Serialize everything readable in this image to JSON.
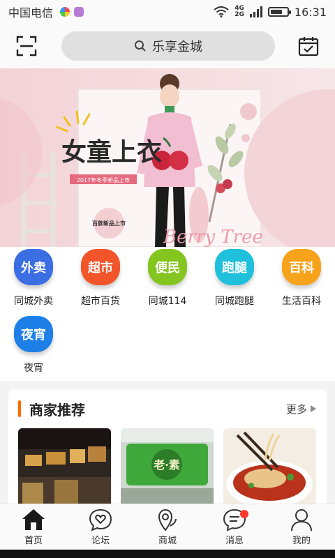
{
  "status_bar": {
    "carrier": "中国电信",
    "network_top": "4G",
    "network_bottom": "2G",
    "battery_level": 0.75,
    "time": "16:31"
  },
  "top_bar": {
    "scan_icon": "scan-icon",
    "search_icon": "search-icon",
    "search_text": "乐享金城",
    "calendar_icon": "calendar-check-icon"
  },
  "banner": {
    "headline": "女童上衣",
    "tag": "2017年冬季新品上市",
    "small_caption": "百款新品上市",
    "script_text": "Berry Tree"
  },
  "categories": [
    {
      "badge": "外卖",
      "label": "同城外卖",
      "color": "#3b6de3"
    },
    {
      "badge": "超市",
      "label": "超市百货",
      "color": "#f2552a"
    },
    {
      "badge": "便民",
      "label": "同城114",
      "color": "#84c520"
    },
    {
      "badge": "跑腿",
      "label": "同城跑腿",
      "color": "#1fc0dc"
    },
    {
      "badge": "百科",
      "label": "生活百科",
      "color": "#f6a21a"
    },
    {
      "badge": "夜宵",
      "label": "夜宵",
      "color": "#1f7fe8"
    }
  ],
  "merchants": {
    "title": "商家推荐",
    "more_label": "更多",
    "accent_color": "#ff6a00"
  },
  "tabs": [
    {
      "label": "首页",
      "icon": "home-icon"
    },
    {
      "label": "论坛",
      "icon": "heart-chat-icon"
    },
    {
      "label": "商城",
      "icon": "map-pin-icon"
    },
    {
      "label": "消息",
      "icon": "message-icon"
    },
    {
      "label": "我的",
      "icon": "user-icon"
    }
  ]
}
